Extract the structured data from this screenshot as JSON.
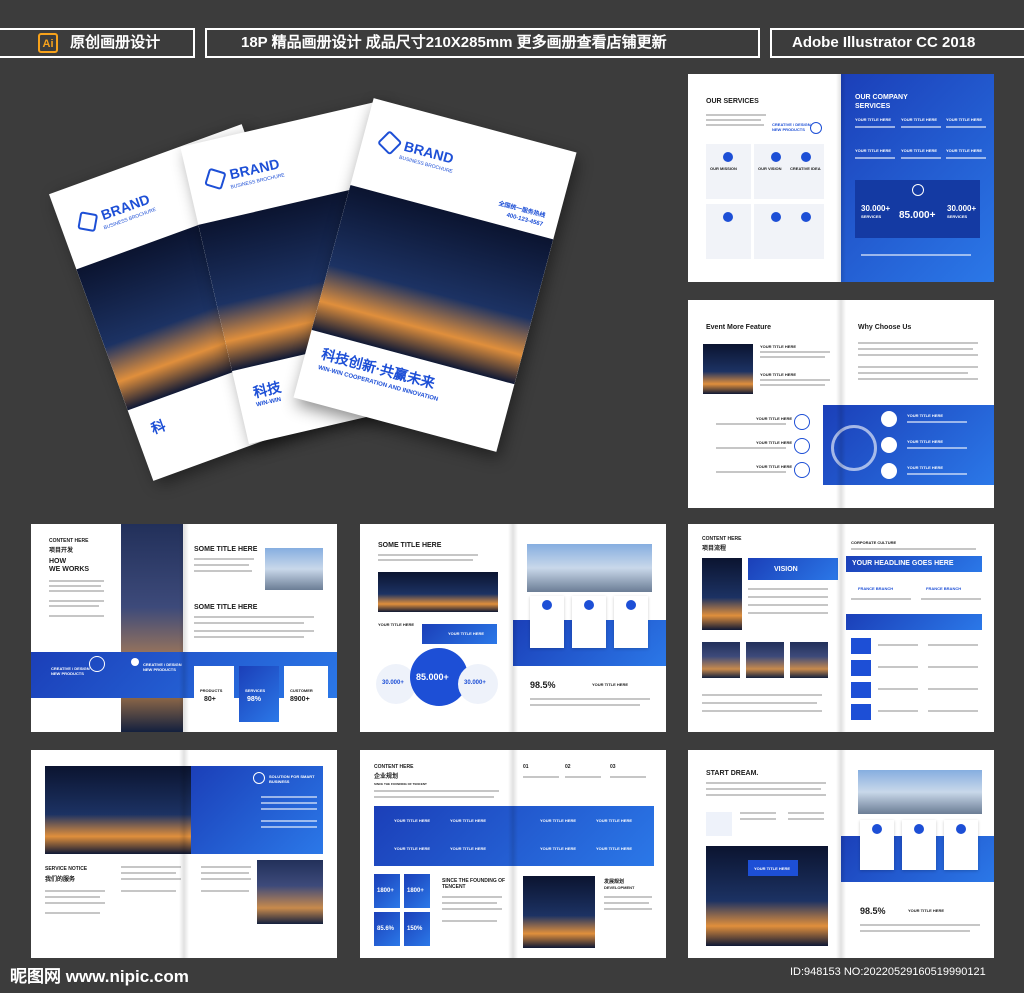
{
  "banner": {
    "left_label": "原创画册设计",
    "ai_badge": "Ai",
    "center_label": "18P 精品画册设计 成品尺寸210X285mm 更多画册查看店铺更新",
    "right_label": "Adobe Illustrator CC 2018"
  },
  "covers": {
    "brand": "BRAND",
    "brochure": "BUSINESS BROCHURE",
    "slogan_cn": "科技创新·共赢未来",
    "slogan_en": "WIN-WIN COOPERATION AND INNOVATION",
    "phone_label": "全国统一服务热线",
    "phone": "400-123-4567",
    "slogan_cn_short": "科技",
    "slogan_en_short": "WIN-WIN",
    "back_cn": "科"
  },
  "p1": {
    "left_title": "OUR SERVICES",
    "right_title_1": "OUR COMPANY",
    "right_title_2": "SERVICES",
    "tile_label": "OUR MISSION",
    "tile_label_2": "OUR VISION",
    "tile_label_3": "CREATIVE IDEA",
    "creative": "CREATIVE / DESIGN NEW PRODUCTS",
    "your_title": "YOUR TITLE HERE",
    "stat_left": "30.000+",
    "stat_center": "85.000+",
    "stat_right": "30.000+",
    "stat_caption": "SERVICES"
  },
  "p2": {
    "left_title": "Event More Feature",
    "right_title": "Why Choose Us",
    "your_title": "YOUR TITLE HERE"
  },
  "p3": {
    "content_here": "CONTENT HERE",
    "cn_title": "项目开发",
    "how": "HOW",
    "we_works": "WE WORKS",
    "some_title": "SOME TITLE HERE",
    "creative": "CREATIVE / DESIGN NEW PRODUCTS",
    "products": "PRODUCTS",
    "services": "SERVICES",
    "customer": "CUSTOMER",
    "products_val": "80+",
    "services_val": "98%",
    "customer_val": "8900+"
  },
  "p4": {
    "some_title": "SOME TITLE HERE",
    "your_title": "YOUR TITLE HERE",
    "stat_left": "30.000+",
    "stat_center": "85.000+",
    "stat_right": "30.000+",
    "percent": "98.5%"
  },
  "p5": {
    "content_here": "CONTENT HERE",
    "cn_title": "项目流程",
    "corporate": "CORPORATE CULTURE",
    "headline": "YOUR HEADLINE GOES HERE",
    "vision": "VISION",
    "branch": "FRANCE BRANCH"
  },
  "p6": {
    "solution": "SOLUTION FOR SMART BUSINESS",
    "notice": "SERVICE NOTICE",
    "cn_title": "我们的服务"
  },
  "p7": {
    "content_here": "CONTENT HERE",
    "cn_title": "企业规划",
    "since": "SINCE THE FOUNDING OF TENCENT",
    "dev_cn": "发展规划",
    "dev_en": "DEVELOPMENT",
    "num1": "1800+",
    "num2": "1800+",
    "num3": "85.6%",
    "num4": "150%",
    "steps": [
      "01",
      "02",
      "03"
    ],
    "your_title": "YOUR TITLE HERE"
  },
  "p8": {
    "start": "START DREAM.",
    "percent": "98.5%",
    "your_title": "YOUR TITLE HERE"
  },
  "watermark": {
    "site": "昵图网 www.nipic.com",
    "id": "ID:948153 NO:20220529160519990121"
  }
}
